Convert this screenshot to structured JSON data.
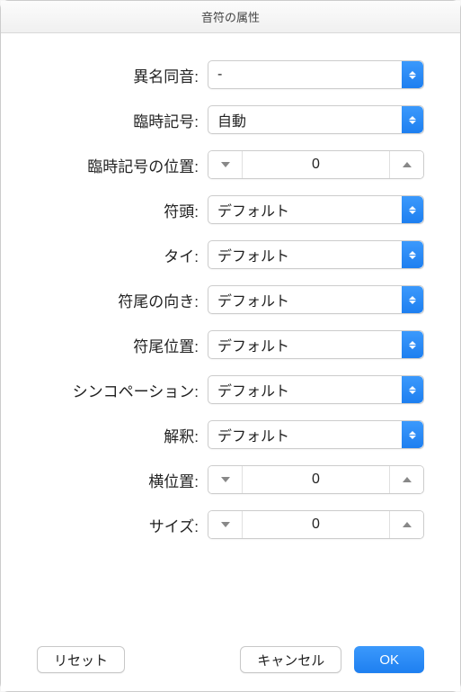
{
  "title": "音符の属性",
  "fields": {
    "enharmonic": {
      "label": "異名同音:",
      "value": "-"
    },
    "accidental": {
      "label": "臨時記号:",
      "value": "自動"
    },
    "accidental_position": {
      "label": "臨時記号の位置:",
      "value": "0"
    },
    "notehead": {
      "label": "符頭:",
      "value": "デフォルト"
    },
    "tie": {
      "label": "タイ:",
      "value": "デフォルト"
    },
    "stem_direction": {
      "label": "符尾の向き:",
      "value": "デフォルト"
    },
    "stem_position": {
      "label": "符尾位置:",
      "value": "デフォルト"
    },
    "syncopation": {
      "label": "シンコペーション:",
      "value": "デフォルト"
    },
    "interpretation": {
      "label": "解釈:",
      "value": "デフォルト"
    },
    "horizontal_position": {
      "label": "横位置:",
      "value": "0"
    },
    "size": {
      "label": "サイズ:",
      "value": "0"
    }
  },
  "buttons": {
    "reset": "リセット",
    "cancel": "キャンセル",
    "ok": "OK"
  }
}
